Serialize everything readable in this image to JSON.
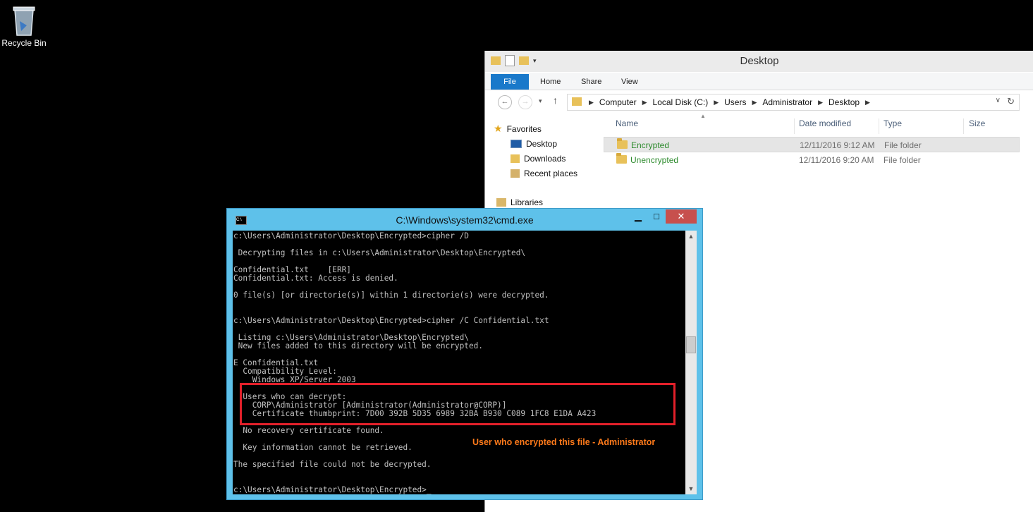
{
  "desktop": {
    "recycle_bin_label": "Recycle Bin"
  },
  "explorer": {
    "title": "Desktop",
    "ribbon_tabs": [
      "File",
      "Home",
      "Share",
      "View"
    ],
    "breadcrumbs": [
      "Computer",
      "Local Disk (C:)",
      "Users",
      "Administrator",
      "Desktop"
    ],
    "nav_pane": {
      "favorites": "Favorites",
      "favorites_items": [
        "Desktop",
        "Downloads",
        "Recent places"
      ],
      "libraries": "Libraries"
    },
    "columns": [
      "Name",
      "Date modified",
      "Type",
      "Size"
    ],
    "files": [
      {
        "name": "Encrypted",
        "date": "12/11/2016 9:12 AM",
        "type": "File folder"
      },
      {
        "name": "Unencrypted",
        "date": "12/11/2016 9:20 AM",
        "type": "File folder"
      }
    ]
  },
  "cmd": {
    "title": "C:\\Windows\\system32\\cmd.exe",
    "icon_label": "C:\\",
    "buttons": {
      "minimize": "▁",
      "maximize": "□",
      "close": "✕"
    },
    "output": "c:\\Users\\Administrator\\Desktop\\Encrypted>cipher /D\n\n Decrypting files in c:\\Users\\Administrator\\Desktop\\Encrypted\\\n\nConfidential.txt    [ERR]\nConfidential.txt: Access is denied.\n\n0 file(s) [or directorie(s)] within 1 directorie(s) were decrypted.\n\n\nc:\\Users\\Administrator\\Desktop\\Encrypted>cipher /C Confidential.txt\n\n Listing c:\\Users\\Administrator\\Desktop\\Encrypted\\\n New files added to this directory will be encrypted.\n\nE Confidential.txt\n  Compatibility Level:\n    Windows XP/Server 2003\n\n  Users who can decrypt:\n    CORP\\Administrator [Administrator(Administrator@CORP)]\n    Certificate thumbprint: 7D00 392B 5D35 6989 32BA B930 C089 1FC8 E1DA A423\n\n  No recovery certificate found.\n\n  Key information cannot be retrieved.\n\nThe specified file could not be decrypted.\n\n\nc:\\Users\\Administrator\\Desktop\\Encrypted>_"
  },
  "annotation": "User who encrypted this file - Administrator",
  "colors": {
    "cmd_frame": "#5ec1ea",
    "highlight_box": "#e2202a",
    "annotation_text": "#ff7a1a",
    "file_tab": "#1979ca"
  }
}
